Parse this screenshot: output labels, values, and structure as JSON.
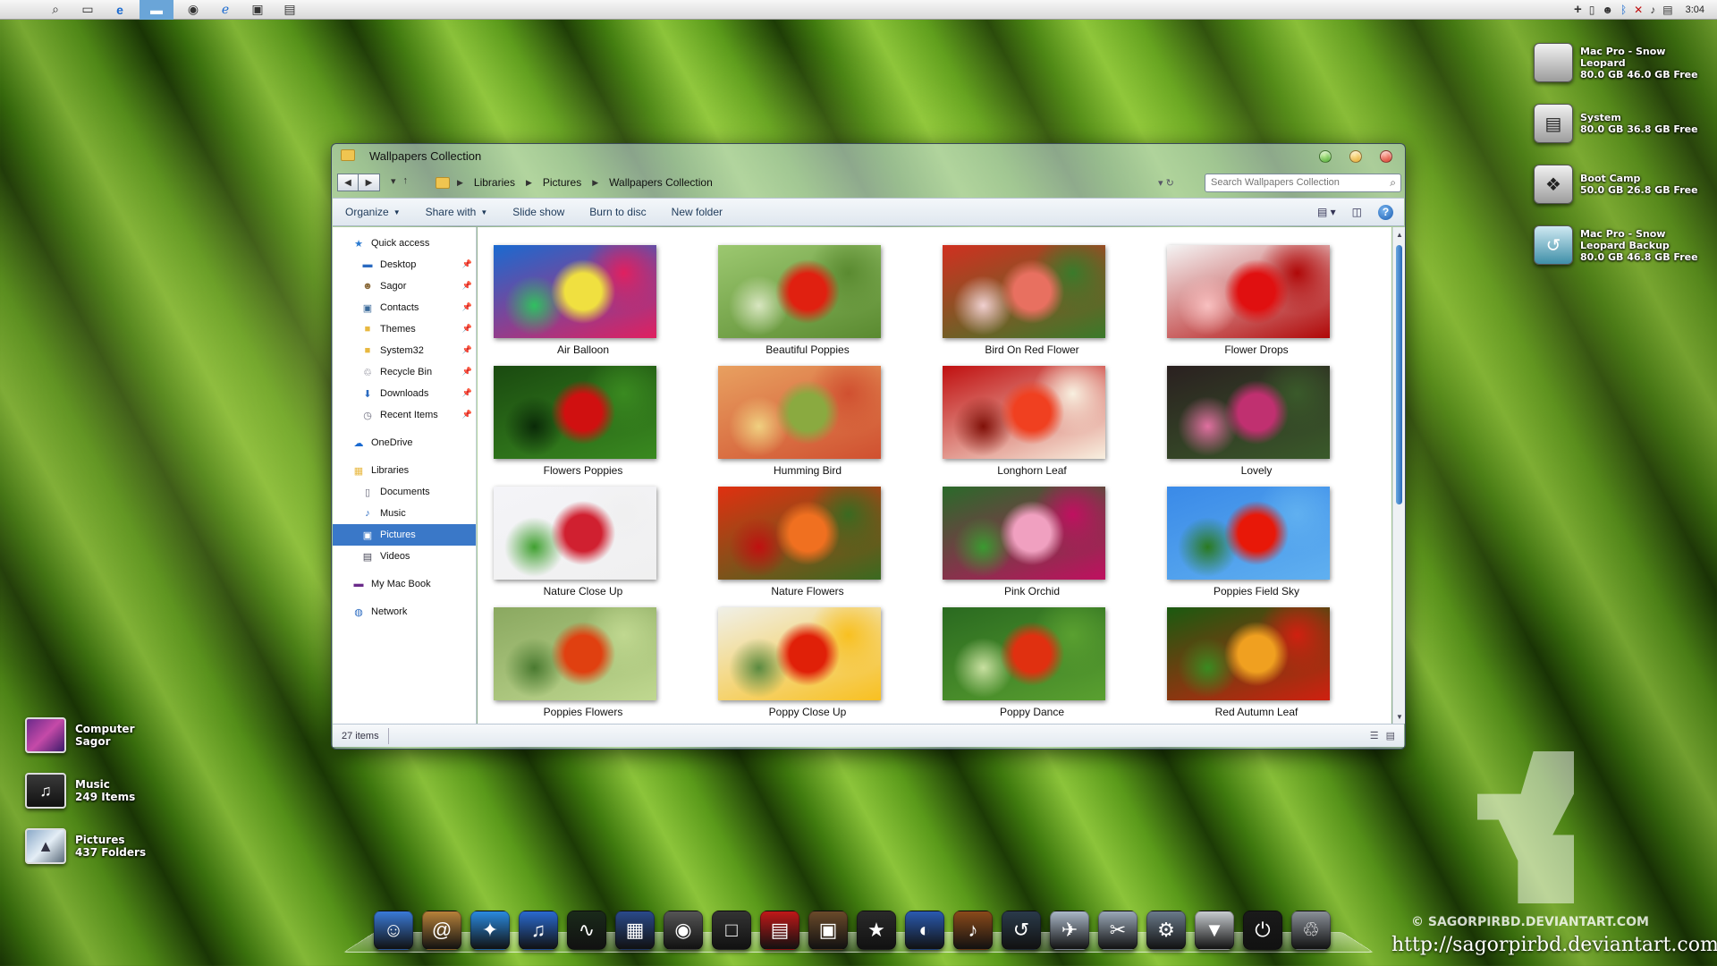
{
  "menubar": {
    "left_icons": [
      "apple-icon",
      "search-icon",
      "task-view-icon",
      "edge-icon",
      "explorer-icon",
      "disc-icon",
      "ie-icon",
      "monitor-icon",
      "store-icon"
    ],
    "tray_icons": [
      "plus-icon",
      "usb-icon",
      "person-icon",
      "bluetooth-icon",
      "network-icon",
      "volume-icon",
      "notification-icon"
    ],
    "clock": "3:04"
  },
  "drives": [
    {
      "line1": "Mac Pro - Snow",
      "line2": "Leopard",
      "line3": "80.0 GB 46.0 GB Free",
      "icon": "hard-drive-apple-icon"
    },
    {
      "line1": "System",
      "line2": "80.0 GB 36.8 GB Free",
      "line3": "",
      "icon": "hard-drive-icon"
    },
    {
      "line1": "Boot Camp",
      "line2": "50.0 GB 26.8 GB Free",
      "line3": "",
      "icon": "boot-camp-icon"
    },
    {
      "line1": "Mac Pro - Snow",
      "line2": "Leopard Backup",
      "line3": "80.0 GB 46.8 GB Free",
      "icon": "time-machine-icon"
    }
  ],
  "desktop_items": [
    {
      "line1": "Computer",
      "line2": "Sagor",
      "icon": "computer-icon"
    },
    {
      "line1": "Music",
      "line2": "249 Items",
      "icon": "music-icon"
    },
    {
      "line1": "Pictures",
      "line2": "437 Folders",
      "icon": "pictures-icon"
    }
  ],
  "window": {
    "title": "Wallpapers Collection",
    "breadcrumb": [
      "Libraries",
      "Pictures",
      "Wallpapers Collection"
    ],
    "search_placeholder": "Search Wallpapers Collection",
    "commands": [
      "Organize",
      "Share with",
      "Slide show",
      "Burn to disc",
      "New folder"
    ],
    "help_label": "?",
    "status_count": "27 items"
  },
  "nav": {
    "quick_access": {
      "label": "Quick access",
      "items": [
        "Desktop",
        "Sagor",
        "Contacts",
        "Themes",
        "System32",
        "Recycle Bin",
        "Downloads",
        "Recent Items"
      ]
    },
    "onedrive": "OneDrive",
    "libraries": {
      "label": "Libraries",
      "items": [
        "Documents",
        "Music",
        "Pictures",
        "Videos"
      ],
      "selected": "Pictures"
    },
    "mac_book": "My Mac Book",
    "network": "Network"
  },
  "files": [
    {
      "name": "Air Balloon",
      "colors": [
        "#1a6ad0",
        "#f0e040",
        "#e02060",
        "#30c060"
      ]
    },
    {
      "name": "Beautiful Poppies",
      "colors": [
        "#9cc870",
        "#e02010",
        "#5a8a30",
        "#d8e6c0"
      ]
    },
    {
      "name": "Bird On Red Flower",
      "colors": [
        "#d03020",
        "#e87060",
        "#3a7a2a",
        "#f0d0d0"
      ]
    },
    {
      "name": "Flower Drops",
      "colors": [
        "#f4f4f4",
        "#e01010",
        "#b00808",
        "#f8c0c0"
      ]
    },
    {
      "name": "Flowers Poppies",
      "colors": [
        "#1a4a10",
        "#d01010",
        "#3a8a20",
        "#0a2a08"
      ]
    },
    {
      "name": "Humming Bird",
      "colors": [
        "#e8a060",
        "#8aaa40",
        "#d05030",
        "#f0d080"
      ]
    },
    {
      "name": "Longhorn Leaf",
      "colors": [
        "#c01010",
        "#f04020",
        "#f8f0e0",
        "#801008"
      ]
    },
    {
      "name": "Lovely",
      "colors": [
        "#2a2020",
        "#c03070",
        "#3a5a2a",
        "#e070a0"
      ]
    },
    {
      "name": "Nature Close Up",
      "colors": [
        "#f4f4f8",
        "#d02030",
        "#f0f0f0",
        "#40a030"
      ]
    },
    {
      "name": "Nature Flowers",
      "colors": [
        "#e03010",
        "#f07020",
        "#3a6a20",
        "#c01010"
      ]
    },
    {
      "name": "Pink Orchid",
      "colors": [
        "#2a6a2a",
        "#f0a0c0",
        "#c01060",
        "#3a9a30"
      ]
    },
    {
      "name": "Poppies Field Sky",
      "colors": [
        "#3a8ae8",
        "#e81808",
        "#60b0f0",
        "#2a7a20"
      ]
    },
    {
      "name": "Poppies Flowers",
      "colors": [
        "#8aa860",
        "#e04010",
        "#c0d890",
        "#4a7a30"
      ]
    },
    {
      "name": "Poppy Close Up",
      "colors": [
        "#f0f0e8",
        "#e02008",
        "#f8c020",
        "#5a8a40"
      ]
    },
    {
      "name": "Poppy Dance",
      "colors": [
        "#2a6a20",
        "#e03010",
        "#5aa030",
        "#c8e0a0"
      ]
    },
    {
      "name": "Red Autumn Leaf",
      "colors": [
        "#1a5a10",
        "#f0a020",
        "#d02010",
        "#3a8a20"
      ]
    }
  ],
  "dock": [
    {
      "icon": "finder-icon",
      "color": "#3a7ad8",
      "glyph": "☺"
    },
    {
      "icon": "address-book-icon",
      "color": "#b8823a",
      "glyph": "@"
    },
    {
      "icon": "safari-icon",
      "color": "#2a8ae0",
      "glyph": "✦"
    },
    {
      "icon": "itunes-icon",
      "color": "#2a6ad0",
      "glyph": "♫"
    },
    {
      "icon": "activity-monitor-icon",
      "color": "#1a2a1a",
      "glyph": "∿"
    },
    {
      "icon": "dashboard-icon",
      "color": "#2a4a8a",
      "glyph": "▦"
    },
    {
      "icon": "webcam-icon",
      "color": "#555555",
      "glyph": "◉"
    },
    {
      "icon": "blank-app-icon",
      "color": "#333333",
      "glyph": "□"
    },
    {
      "icon": "photo-booth-icon",
      "color": "#c01818",
      "glyph": "▤"
    },
    {
      "icon": "iphoto-icon",
      "color": "#6a4a2a",
      "glyph": "▣"
    },
    {
      "icon": "imovie-icon",
      "color": "#2a2a2a",
      "glyph": "★"
    },
    {
      "icon": "firefox-icon",
      "color": "#2a5ab0",
      "glyph": "◐"
    },
    {
      "icon": "garageband-icon",
      "color": "#8a4a1a",
      "glyph": "♪"
    },
    {
      "icon": "time-machine-icon",
      "color": "#2a3a4a",
      "glyph": "↺"
    },
    {
      "icon": "mail-icon",
      "color": "#aab8c8",
      "glyph": "✈"
    },
    {
      "icon": "preview-icon",
      "color": "#9aa8b8",
      "glyph": "✂"
    },
    {
      "icon": "utilities-icon",
      "color": "#6a7a8a",
      "glyph": "⚙"
    },
    {
      "icon": "downloads-icon",
      "color": "#c8ccd0",
      "glyph": "▼"
    },
    {
      "icon": "shutdown-icon",
      "color": "#1a1a1a",
      "glyph": "⏻"
    },
    {
      "icon": "trash-icon",
      "color": "#8a9098",
      "glyph": "♲"
    }
  ],
  "watermark": {
    "copyright": "© SAGORPIRBD.DEVIANTART.COM",
    "url": "http://sagorpirbd.deviantart.com"
  }
}
